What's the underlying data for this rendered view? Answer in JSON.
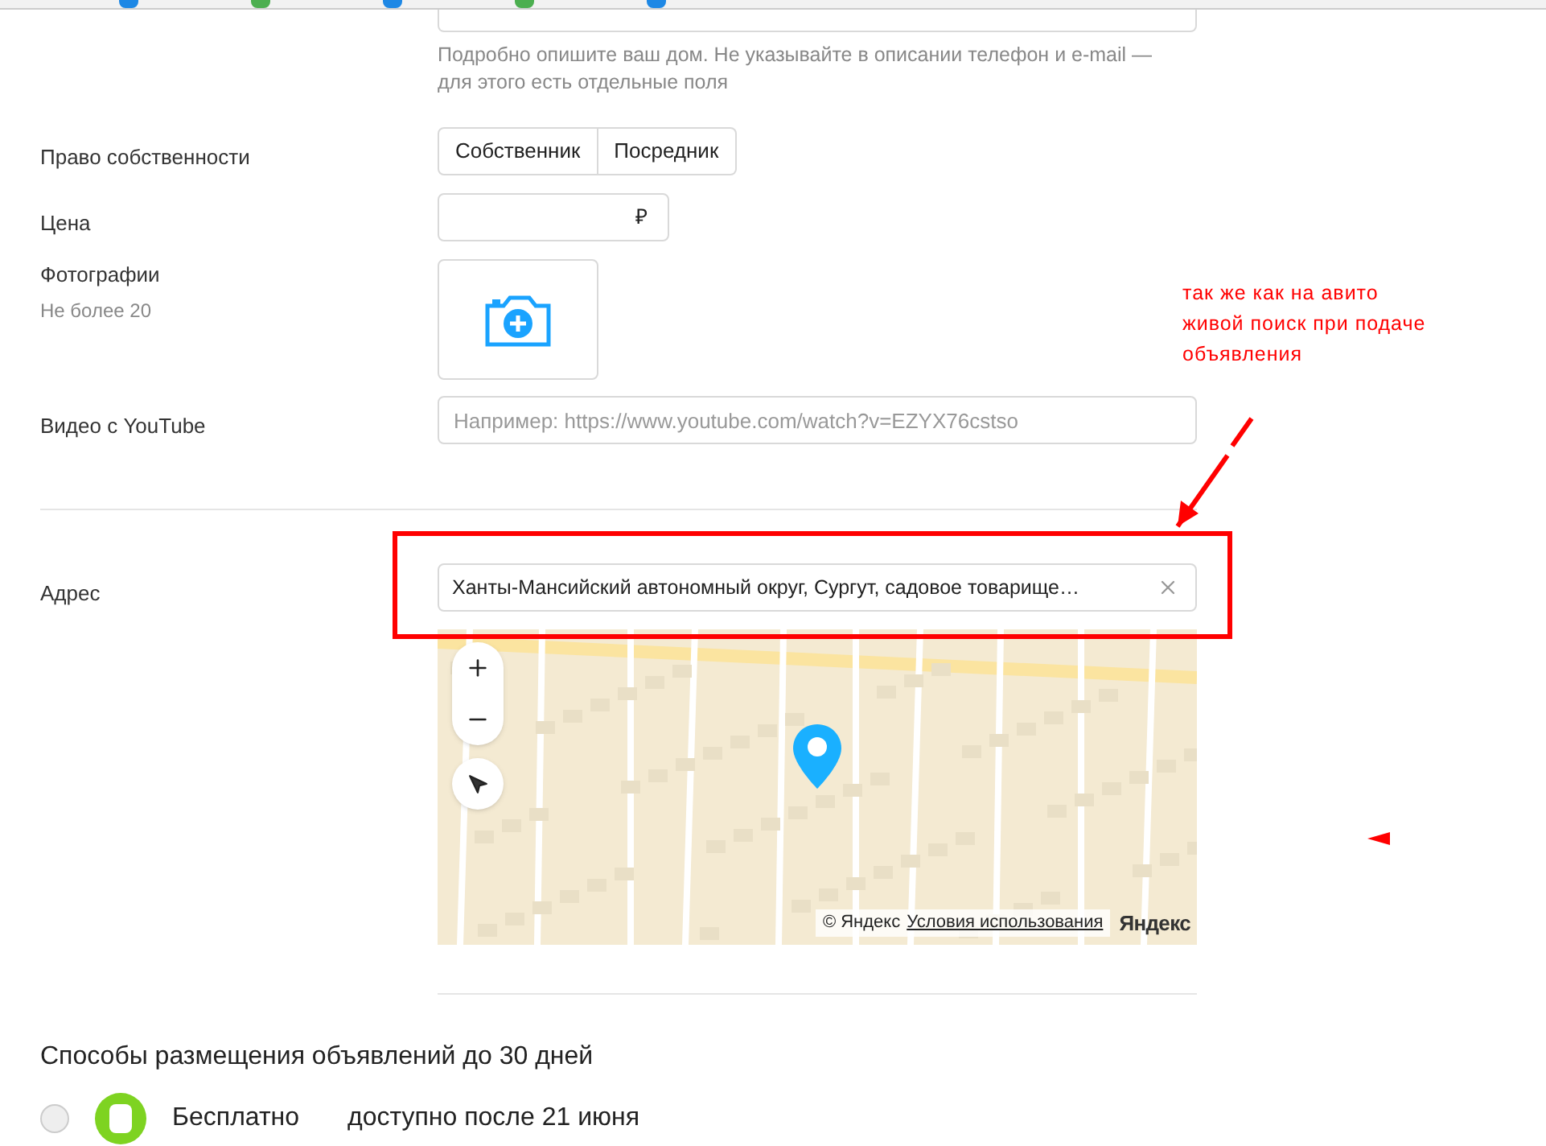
{
  "description": {
    "hint": "Подробно опишите ваш дом. Не указывайте в описании телефон и e-mail — для этого есть отдельные поля"
  },
  "ownership": {
    "label": "Право собственности",
    "options": [
      {
        "label": "Собственник",
        "selected": false
      },
      {
        "label": "Посредник",
        "selected": false
      }
    ]
  },
  "price": {
    "label": "Цена",
    "currency": "₽"
  },
  "photos": {
    "label": "Фотографии",
    "note": "Не более 20"
  },
  "video": {
    "label": "Видео с YouTube",
    "placeholder": "Например: https://www.youtube.com/watch?v=EZYX76cstso"
  },
  "address": {
    "label": "Адрес",
    "value": "Ханты-Мансийский автономный округ, Сургут, садовое товарище…"
  },
  "map": {
    "copyright": "© Яндекс",
    "terms": "Условия использования",
    "logo": "Яндекс"
  },
  "annotation": {
    "text": "так же как на авито\nживой поиск при подаче\nобъявления"
  },
  "placement": {
    "title": "Способы размещения объявлений до 30 дней",
    "options": [
      {
        "name": "Бесплатно",
        "note": "доступно после 21 июня",
        "selected": false
      }
    ]
  }
}
